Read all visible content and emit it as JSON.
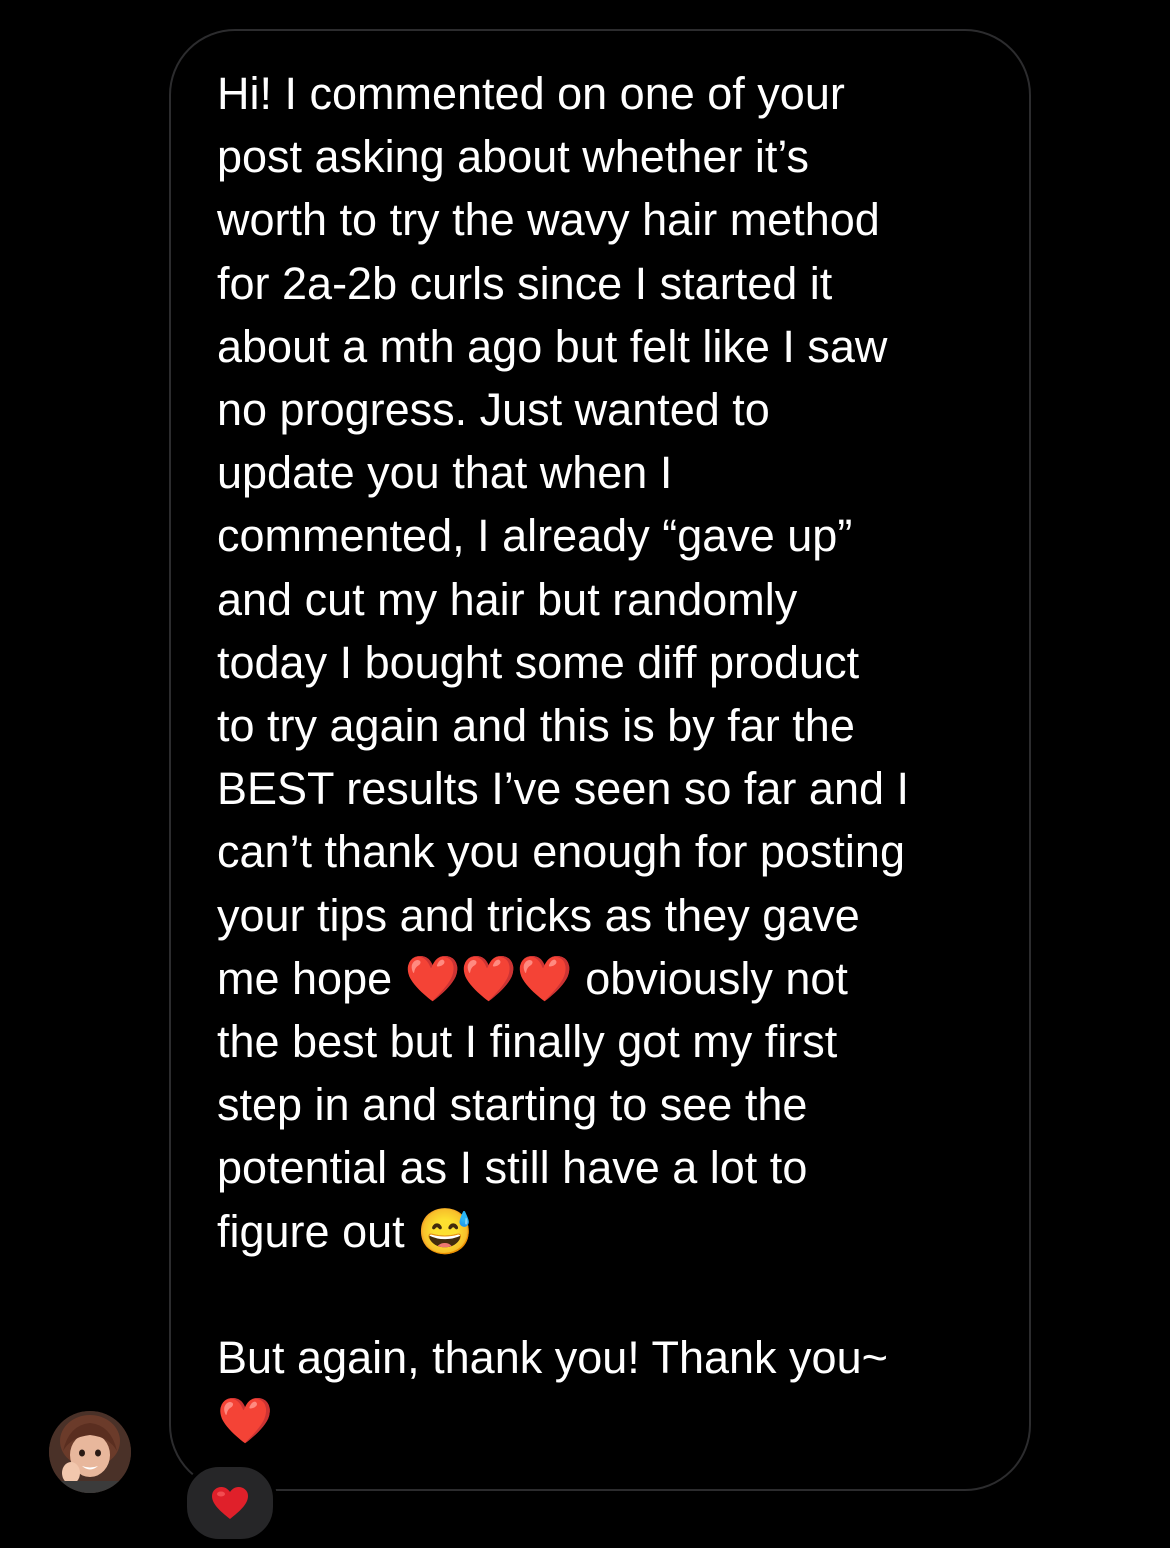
{
  "message": {
    "text": "Hi! I commented on one of your\npost asking about whether it’s\nworth to try the wavy hair method\nfor 2a-2b curls since I started it\nabout a mth ago but felt like I saw\nno progress. Just wanted to\nupdate you that when I\ncommented, I already “gave up”\nand cut my hair but randomly\ntoday I bought some diff product\nto try again and this is by far the\nBEST results I’ve seen so far and I\ncan’t thank you enough for posting\nyour tips and tricks as they gave\nme hope ❤️❤️❤️ obviously not\nthe best but I finally got my first\nstep in and starting to see the\npotential as I still have a lot to\nfigure out 😅\n\nBut again, thank you! Thank you~\n❤️"
  },
  "reaction": {
    "icon": "red-heart-icon"
  },
  "avatar": {
    "icon": "sender-avatar"
  },
  "colors": {
    "background": "#000000",
    "bubble_border": "#2c2c2e",
    "text": "#ffffff",
    "reaction_pill": "#262628",
    "heart": "#e0202a"
  }
}
